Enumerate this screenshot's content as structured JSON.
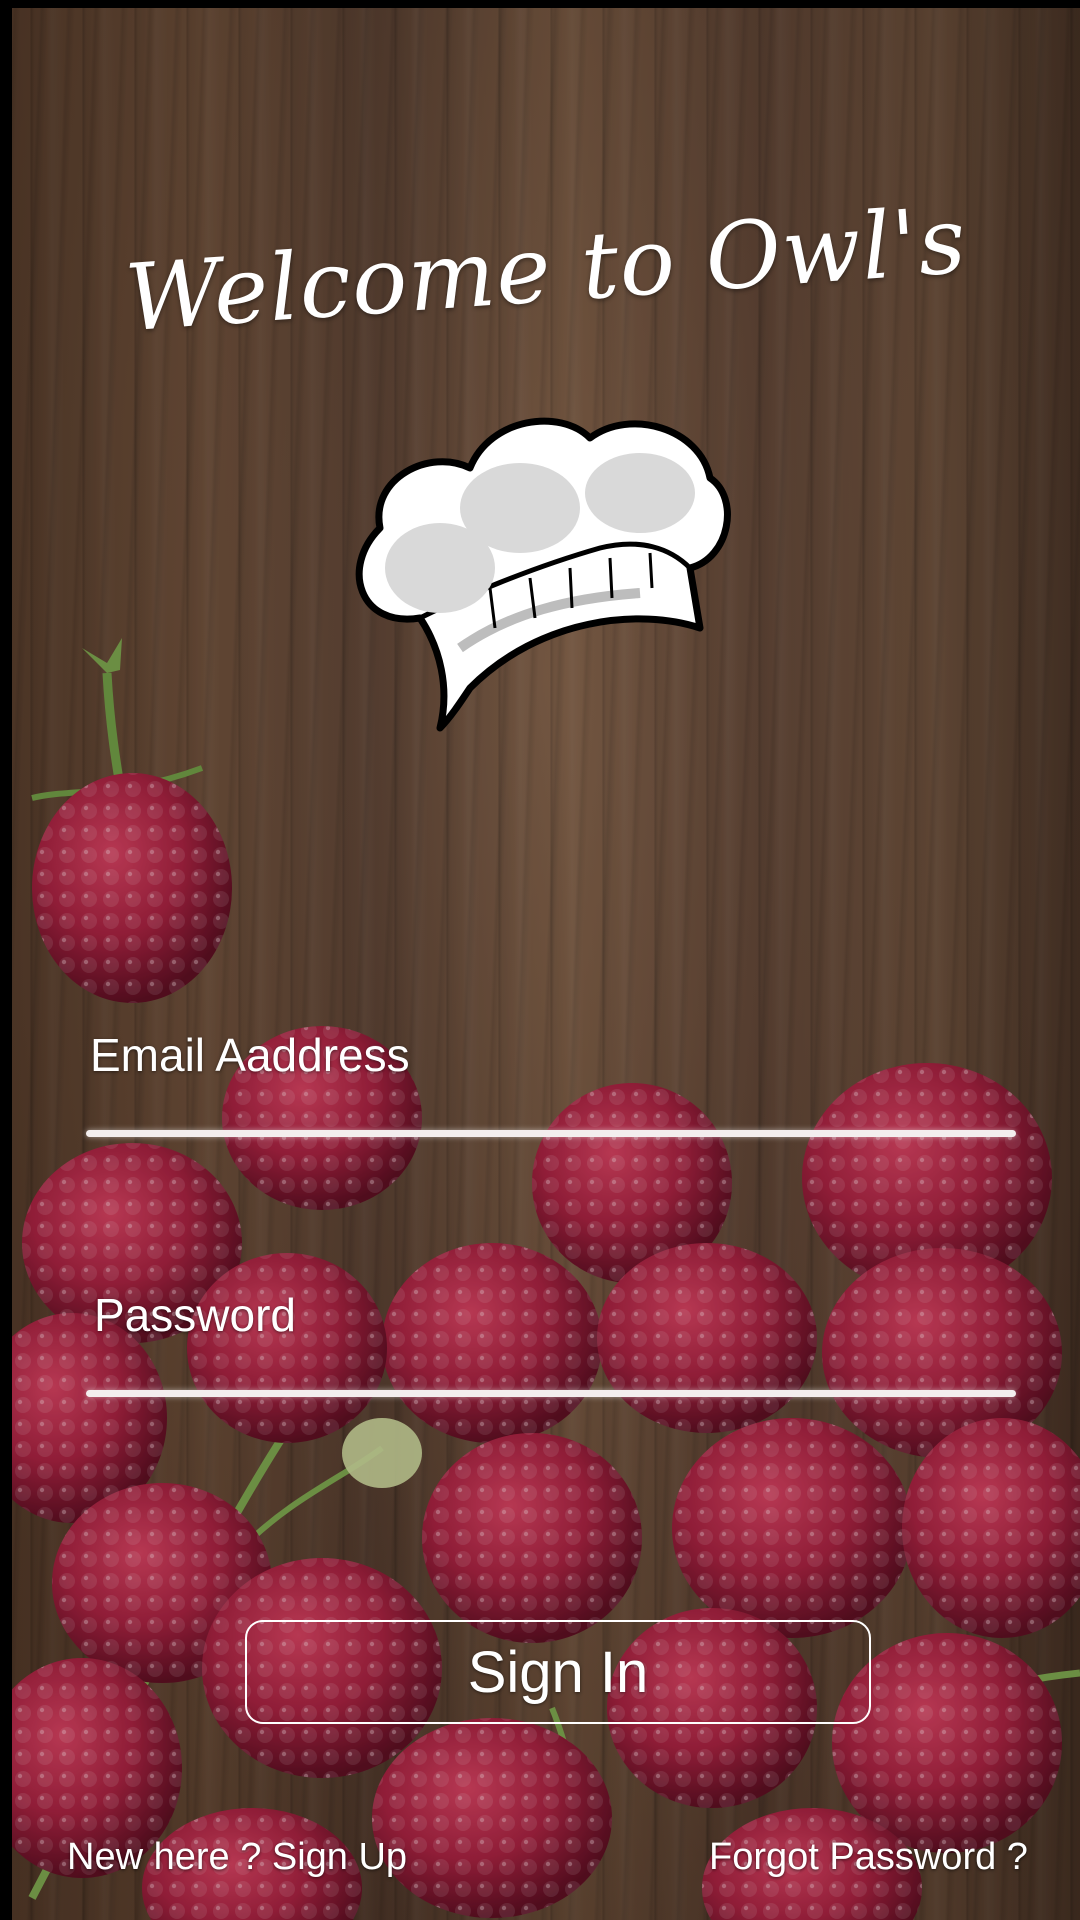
{
  "title": "Welcome to Owl's",
  "logo": {
    "icon": "chef-hat-icon"
  },
  "form": {
    "email_label": "Email Aaddress",
    "password_label": "Password"
  },
  "actions": {
    "sign_in_label": "Sign In",
    "sign_up_link": "New here ? Sign Up",
    "forgot_password_link": "Forgot Password ?"
  },
  "colors": {
    "text": "#ffffff",
    "wood": "#6b4a34",
    "berry": "#a3213f"
  }
}
